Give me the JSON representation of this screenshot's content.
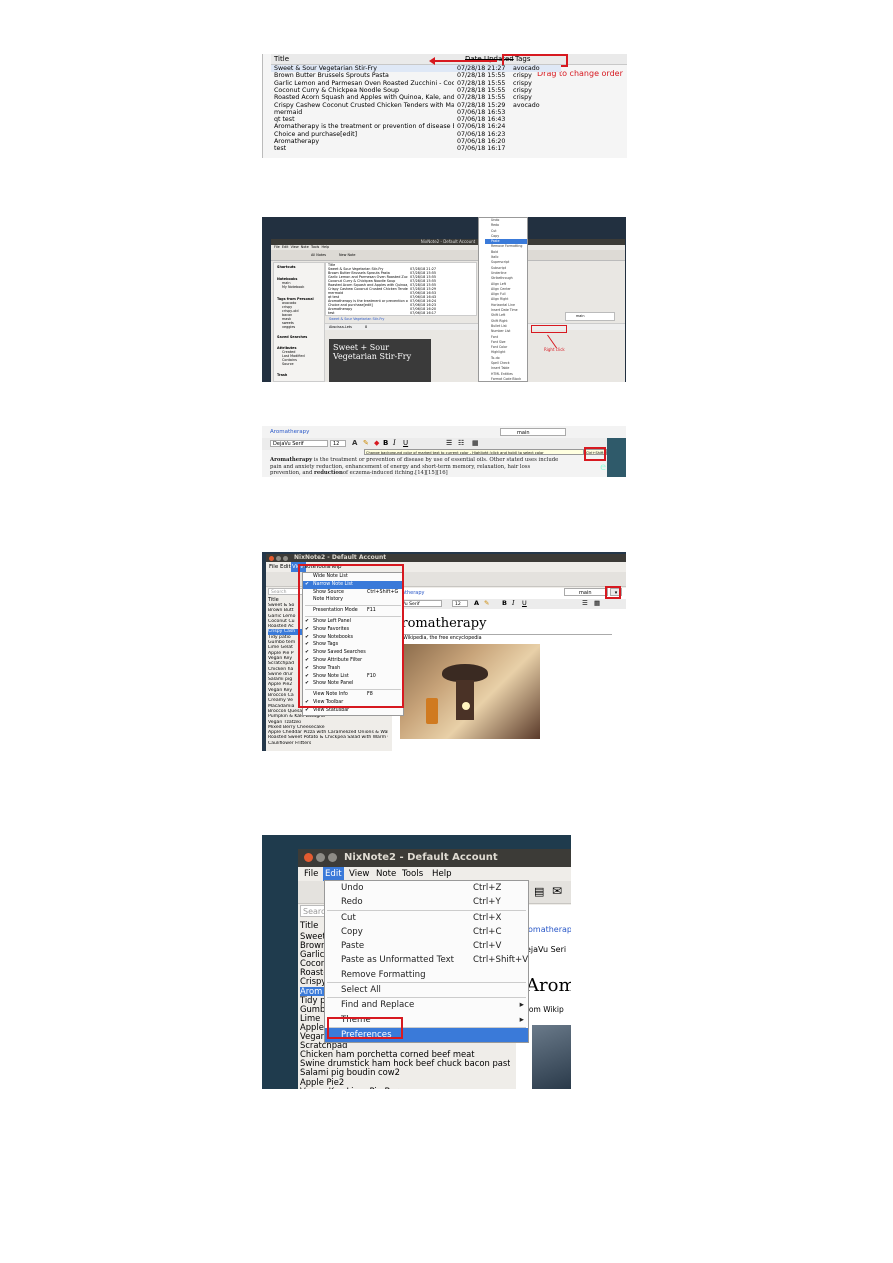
{
  "shot1": {
    "headers": {
      "title": "Title",
      "date_updated": "Date Updated",
      "tags": "Tags"
    },
    "annotation": "Drag to change order",
    "rows": [
      {
        "title": "Sweet & Sour Vegetarian Stir-Fry",
        "date": "07/28/18 21:27",
        "tags": "avocado"
      },
      {
        "title": "Brown Butter Brussels Sprouts Pasta",
        "date": "07/28/18 15:55",
        "tags": "crispy"
      },
      {
        "title": "Garlic Lemon and Parmesan Oven Roasted Zucchini - Cook...",
        "date": "07/28/18 15:55",
        "tags": "crispy"
      },
      {
        "title": "Coconut Curry & Chickpea Noodle Soup",
        "date": "07/28/18 15:55",
        "tags": "crispy"
      },
      {
        "title": "Roasted Acorn Squash and Apples with Quinoa, Kale, and ...",
        "date": "07/28/18 15:55",
        "tags": "crispy"
      },
      {
        "title": "Crispy Cashew Coconut Crusted Chicken Tenders with Man...",
        "date": "07/28/18 15:29",
        "tags": "avocado"
      },
      {
        "title": "mermaid",
        "date": "07/06/18 16:53",
        "tags": ""
      },
      {
        "title": "qt test",
        "date": "07/06/18 16:43",
        "tags": ""
      },
      {
        "title": "Aromatherapy is the treatment or prevention of disease b...",
        "date": "07/06/18 16:24",
        "tags": ""
      },
      {
        "title": "Choice and purchase[edit]",
        "date": "07/06/18 16:23",
        "tags": ""
      },
      {
        "title": "Aromatherapy",
        "date": "07/06/18 16:20",
        "tags": ""
      },
      {
        "title": "test",
        "date": "07/06/18 16:17",
        "tags": ""
      }
    ]
  },
  "shot2": {
    "window_title": "NixNote2 - Default Account",
    "menu": [
      "File",
      "Edit",
      "View",
      "Note",
      "Tools",
      "Help"
    ],
    "toolbar": [
      "All Notes",
      "New Note"
    ],
    "sidebar": {
      "shortcuts": "Shortcuts",
      "notebooks": "Notebooks",
      "notebook_items": [
        "main",
        "My Notebook"
      ],
      "tags_header": "Tags from Personal",
      "tags": [
        "avocado",
        "crispy",
        "crispy-old",
        "bacon",
        "mask",
        "sweets",
        "veggies"
      ],
      "saved_searches": "Saved Searches",
      "attributes": "Attributes",
      "attribute_items": [
        "Created",
        "Last Modified",
        "Contains",
        "Source"
      ],
      "trash": "Trash"
    },
    "note_title": "Sweet & Sour Vegetarian Stir-Fry",
    "font": "Abscissa-Lets",
    "font_size": "8",
    "image_text": "Sweet + Sour Vegetarian Stir-Fry",
    "notebook_select": "main",
    "annotation": "Right click",
    "context_menu": [
      "Undo",
      "Redo",
      "Cut",
      "Copy",
      "Paste",
      "Remove Formatting",
      "Bold",
      "Italic",
      "Superscript",
      "Subscript",
      "Underline",
      "Strikethrough",
      "Align Left",
      "Align Center",
      "Align Full",
      "Align Right",
      "Horizontal Line",
      "Insert Date Time",
      "Shift Left",
      "Shift Right",
      "Bullet List",
      "Number List",
      "Font",
      "Font Size",
      "Font Color",
      "Highlight",
      "To-do",
      "Spell Check",
      "Insert Table",
      "HTML Entities",
      "Format Code Block"
    ],
    "context_selected": "Paste"
  },
  "shot3": {
    "note_link": "Aromatherapy",
    "notebook_select": "main",
    "font": "DejaVu Serif",
    "font_size": "12",
    "tooltip": "Change background color of marked text to current color - Highlight (click and hold) to select color",
    "shortcut": "Ctrl+Shift+H",
    "body_bold_start": "Aromatherapy",
    "body_text": " is the treatment or prevention of disease by use of essential oils. Other stated uses include pain and anxiety reduction, enhancement of energy and short-term memory, relaxation, hair loss prevention, and ",
    "body_bold_mid": "reduction",
    "body_text_end": "of eczema-induced itching.[14][15][16]"
  },
  "shot4": {
    "window_title": "NixNote2 - Default Account",
    "menu": [
      "File",
      "Edit",
      "View",
      "Note",
      "Tools",
      "Help"
    ],
    "view_menu": [
      {
        "label": "Wide Note List",
        "shortcut": "",
        "checked": false
      },
      {
        "label": "Narrow Note List",
        "shortcut": "",
        "checked": true,
        "selected": true
      },
      {
        "label": "Show Source",
        "shortcut": "Ctrl+Shift+G",
        "checked": false
      },
      {
        "label": "Note History",
        "shortcut": "",
        "checked": false
      },
      {
        "label": "Presentation Mode",
        "shortcut": "F11",
        "checked": false
      },
      {
        "label": "Show Left Panel",
        "shortcut": "",
        "checked": true
      },
      {
        "label": "Show Favorites",
        "shortcut": "",
        "checked": true
      },
      {
        "label": "Show Notebooks",
        "shortcut": "",
        "checked": true
      },
      {
        "label": "Show Tags",
        "shortcut": "",
        "checked": true
      },
      {
        "label": "Show Saved Searches",
        "shortcut": "",
        "checked": true
      },
      {
        "label": "Show Attribute Filter",
        "shortcut": "",
        "checked": true
      },
      {
        "label": "Show Trash",
        "shortcut": "",
        "checked": true
      },
      {
        "label": "Show Note List",
        "shortcut": "F10",
        "checked": true
      },
      {
        "label": "Show Note Panel",
        "shortcut": "",
        "checked": true
      },
      {
        "label": "View Note Info",
        "shortcut": "F8",
        "checked": false
      },
      {
        "label": "View Toolbar",
        "shortcut": "",
        "checked": true
      },
      {
        "label": "View Statusbar",
        "shortcut": "",
        "checked": true
      }
    ],
    "list_title": "Title",
    "search": "Search",
    "notes": [
      "Sweet & So",
      "Brown Butt",
      "Garlic Lemo",
      "Coconut Cu",
      "Roasted Ac",
      "Crispy Cash",
      "Tidy patio",
      "Gumbo tem",
      "Lime Gelat",
      "Apple Pie P",
      "Vegan Key",
      "Scratchpad",
      "Chicken ha",
      "Swine drur",
      "Salami pig",
      "Apple Pie2",
      "Vegan Key",
      "Broccoli Ca",
      "Creamy Ve",
      "Macadamia",
      "Broccoli Quesadillas with Avocado Mustard",
      "Pumpkin & Kale Lasagna",
      "Vegan Tzatziki",
      "Mixed Berry Cheesecake",
      "Apple Cheddar Pizza with Caramelized Onions & Walnuts",
      "Roasted Sweet Potato & Chickpea Salad with Warm C",
      "Cauliflower Fritters"
    ],
    "note_link": "omatherapy",
    "notebook_select": "main",
    "font": "ejaVu Serif",
    "font_size": "12",
    "note_heading": "Aromatherapy",
    "note_source": "rom Wikipedia, the free encyclopedia"
  },
  "shot5": {
    "window_title": "NixNote2 - Default Account",
    "menu": [
      "File",
      "Edit",
      "View",
      "Note",
      "Tools",
      "Help"
    ],
    "active_menu": "Edit",
    "edit_menu": [
      {
        "label": "Undo",
        "shortcut": "Ctrl+Z"
      },
      {
        "label": "Redo",
        "shortcut": "Ctrl+Y"
      },
      {
        "label": "Cut",
        "shortcut": "Ctrl+X"
      },
      {
        "label": "Copy",
        "shortcut": "Ctrl+C"
      },
      {
        "label": "Paste",
        "shortcut": "Ctrl+V"
      },
      {
        "label": "Paste as Unformatted Text",
        "shortcut": "Ctrl+Shift+V"
      },
      {
        "label": "Remove Formatting",
        "shortcut": ""
      },
      {
        "label": "Select All",
        "shortcut": ""
      },
      {
        "label": "Find and Replace",
        "shortcut": ""
      },
      {
        "label": "Theme",
        "shortcut": ""
      },
      {
        "label": "Preferences",
        "shortcut": ""
      }
    ],
    "search": "Searc",
    "list_title": "Title",
    "notes": [
      "Sweet",
      "Brown",
      "Garlic",
      "Cocon",
      "Roaste",
      "Crispy",
      "Arom",
      "Tidy p",
      "Gumb",
      "Lime",
      "Apple",
      "Vegan",
      "Scratchpad",
      "Chicken ham porchetta corned beef meat",
      "Swine drumstick ham hock beef chuck bacon pastram",
      "Salami pig boudin cow2",
      "Apple Pie2",
      "Vegan Key Lime Pie Bars"
    ],
    "note_link": "omatherap",
    "font": "ejaVu Seri",
    "note_heading": "Arom",
    "note_source": "rom Wikip"
  }
}
